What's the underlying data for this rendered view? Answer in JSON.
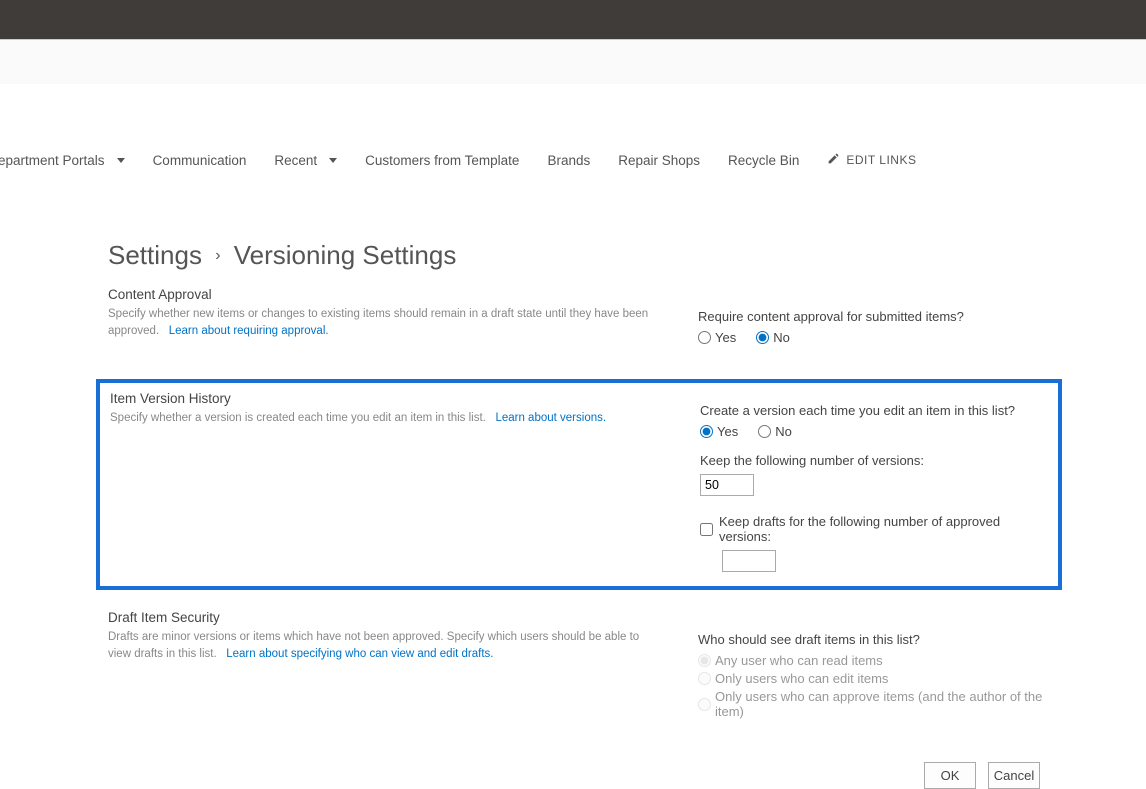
{
  "nav": {
    "items": [
      {
        "label": "epartment Portals",
        "hasDropdown": true
      },
      {
        "label": "Communication",
        "hasDropdown": false
      },
      {
        "label": "Recent",
        "hasDropdown": true
      },
      {
        "label": "Customers from Template",
        "hasDropdown": false
      },
      {
        "label": "Brands",
        "hasDropdown": false
      },
      {
        "label": "Repair Shops",
        "hasDropdown": false
      },
      {
        "label": "Recycle Bin",
        "hasDropdown": false
      }
    ],
    "editLinks": "EDIT LINKS"
  },
  "breadcrumb": {
    "root": "Settings",
    "sep": "›",
    "current": "Versioning Settings"
  },
  "sections": {
    "contentApproval": {
      "title": "Content Approval",
      "desc": "Specify whether new items or changes to existing items should remain in a draft state until they have been approved.",
      "link": "Learn about requiring approval.",
      "question": "Require content approval for submitted items?",
      "yes": "Yes",
      "no": "No",
      "selected": "No"
    },
    "versionHistory": {
      "title": "Item Version History",
      "desc": "Specify whether a version is created each time you edit an item in this list.",
      "link": "Learn about versions.",
      "question": "Create a version each time you edit an item in this list?",
      "yes": "Yes",
      "no": "No",
      "selected": "Yes",
      "keepVersionsLabel": "Keep the following number of versions:",
      "keepVersionsValue": "50",
      "keepDraftsLabel": "Keep drafts for the following number of approved versions:",
      "keepDraftsValue": ""
    },
    "draftSecurity": {
      "title": "Draft Item Security",
      "desc": "Drafts are minor versions or items which have not been approved. Specify which users should be able to view drafts in this list.",
      "link": "Learn about specifying who can view and edit drafts.",
      "question": "Who should see draft items in this list?",
      "options": [
        "Any user who can read items",
        "Only users who can edit items",
        "Only users who can approve items (and the author of the item)"
      ],
      "selected": 0
    }
  },
  "buttons": {
    "ok": "OK",
    "cancel": "Cancel"
  }
}
